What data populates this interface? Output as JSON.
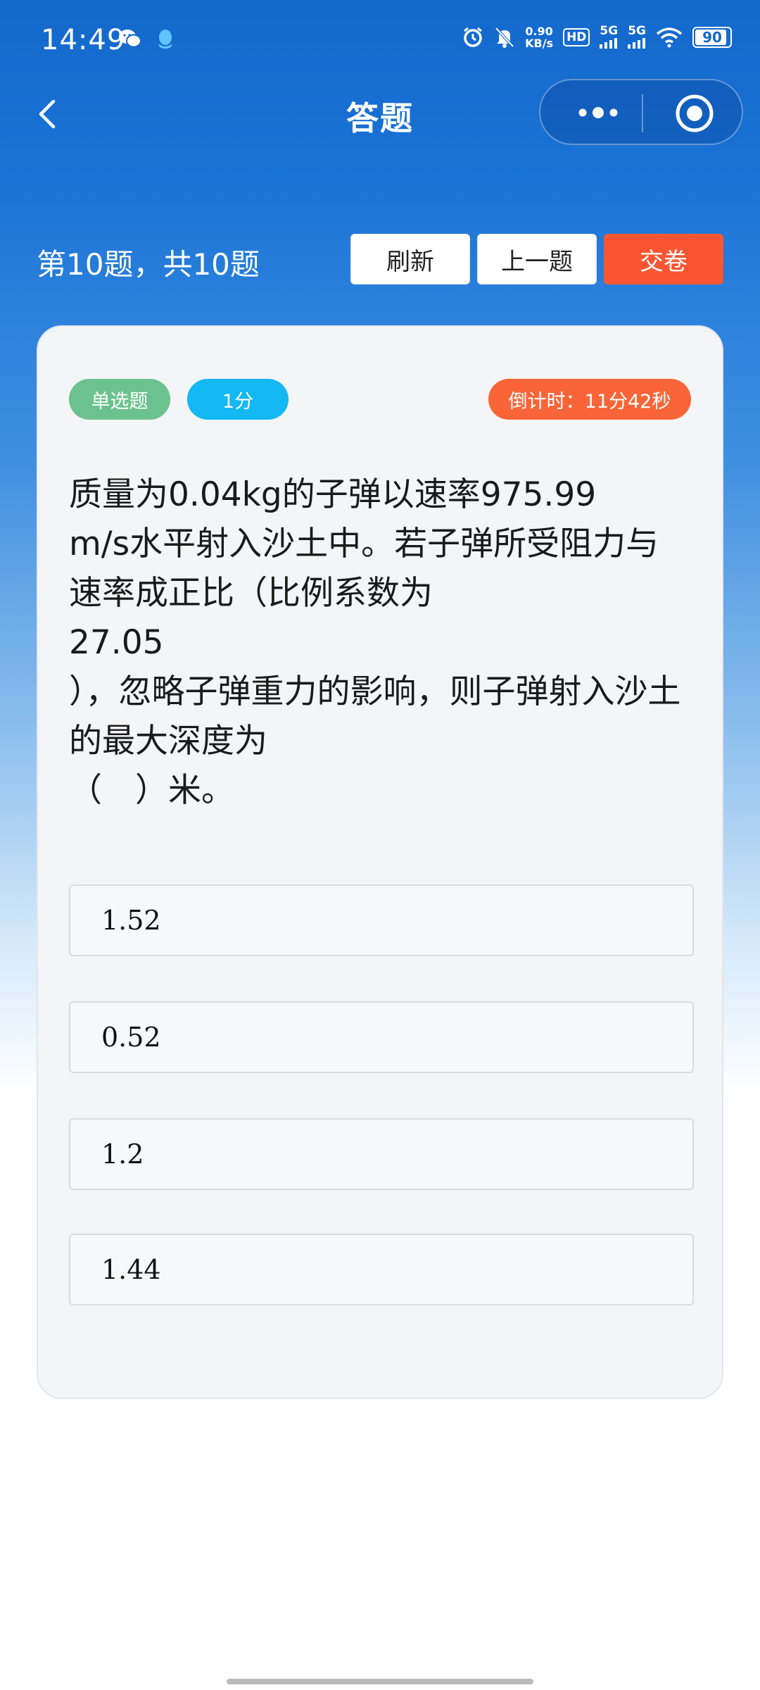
{
  "status_bar": {
    "time": "14:49",
    "net_speed_value": "0.90",
    "net_speed_unit": "KB/s",
    "hd_label": "HD",
    "sim1_label": "5G",
    "sim2_label": "5G",
    "battery": "90",
    "icons": [
      "wechat-icon",
      "qq-icon",
      "alarm-icon",
      "mute-icon",
      "wifi-icon",
      "battery-icon"
    ]
  },
  "nav": {
    "title": "答题",
    "back_icon": "chevron-left-icon",
    "more_icon": "more-dots-icon",
    "close_icon": "target-circle-icon"
  },
  "toolbar": {
    "progress": "第10题，共10题",
    "refresh_label": "刷新",
    "prev_label": "上一题",
    "submit_label": "交卷"
  },
  "question": {
    "type_tag": "单选题",
    "score_tag": "1分",
    "timer": "倒计时：11分42秒",
    "text": "质量为0.04kg的子弹以速率975.99\nm/s水平射入沙土中。若子弹所受阻力与\n速率成正比（比例系数为\n27.05\n），忽略子弹重力的影响，则子弹射入沙土\n的最大深度为\n（　）米。",
    "options": [
      "1.52",
      "0.52",
      "1.2",
      "1.44"
    ]
  },
  "colors": {
    "header_blue": "#1468cc",
    "submit_red": "#fa5532",
    "tag_green": "#6cc28e",
    "tag_blue": "#14b8f2",
    "timer_orange": "#f96538"
  }
}
